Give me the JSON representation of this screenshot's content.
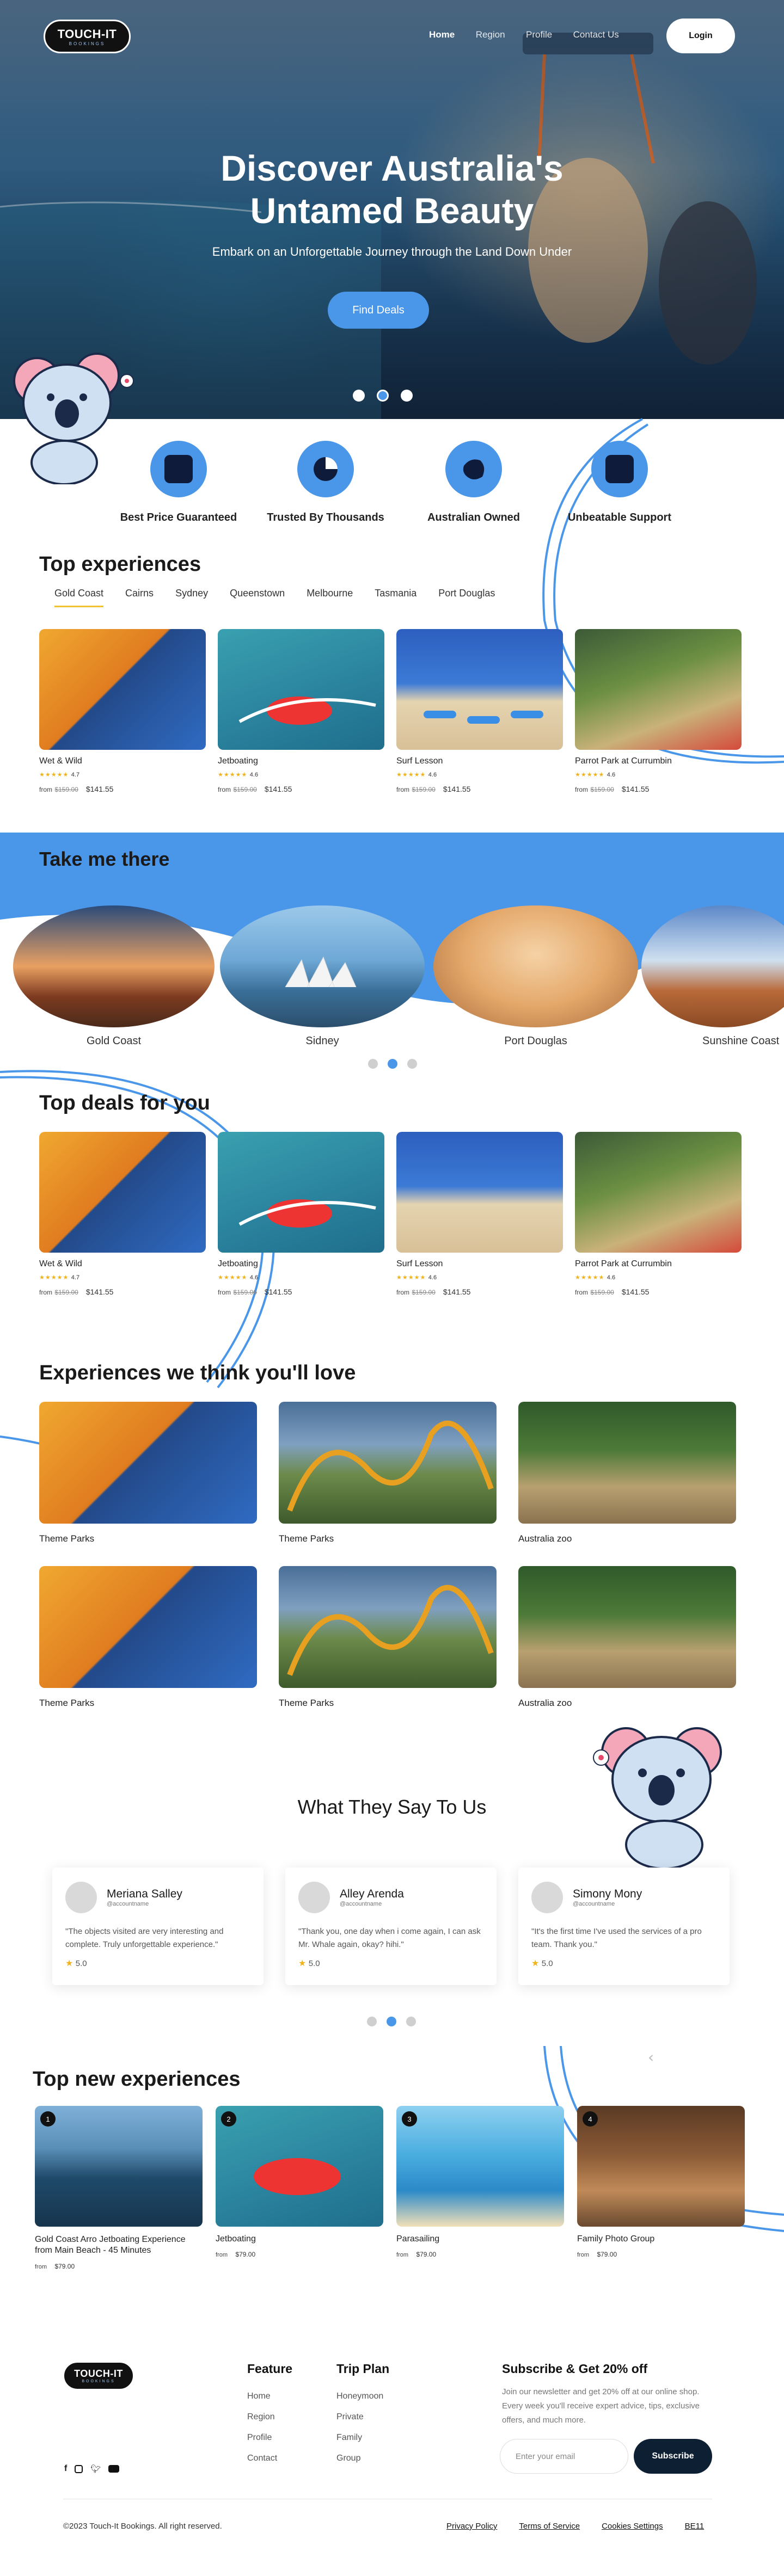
{
  "brand": {
    "name": "TOUCH-IT",
    "tagline": "BOOKINGS"
  },
  "nav": {
    "items": [
      "Home",
      "Region",
      "Profile",
      "Contact Us"
    ],
    "active": "Home",
    "login": "Login"
  },
  "hero": {
    "title": "Discover Australia's Untamed Beauty",
    "subtitle": "Embark on an Unforgettable Journey through the Land Down Under",
    "cta": "Find Deals",
    "slides": 3,
    "active_slide": 2
  },
  "features": [
    {
      "label": "Best Price Guaranteed",
      "icon": "trend-chart-icon"
    },
    {
      "label": "Trusted By Thousands",
      "icon": "pie-chart-icon"
    },
    {
      "label": "Australian Owned",
      "icon": "australia-map-icon"
    },
    {
      "label": "Unbeatable Support",
      "icon": "support-chart-icon"
    }
  ],
  "top_experiences": {
    "title": "Top experiences",
    "tabs": [
      "Gold Coast",
      "Cairns",
      "Sydney",
      "Queenstown",
      "Melbourne",
      "Tasmania",
      "Port Douglas"
    ],
    "active_tab": "Gold Coast",
    "cards": [
      {
        "title": "Wet & Wild",
        "rating": "4.7",
        "from": "from",
        "old_price": "$159.00",
        "price": "$141.55"
      },
      {
        "title": "Jetboating",
        "rating": "4.6",
        "from": "from",
        "old_price": "$159.00",
        "price": "$141.55"
      },
      {
        "title": "Surf Lesson",
        "rating": "4.6",
        "from": "from",
        "old_price": "$159.00",
        "price": "$141.55"
      },
      {
        "title": "Parrot Park at Currumbin",
        "rating": "4.6",
        "from": "from",
        "old_price": "$159.00",
        "price": "$141.55"
      }
    ]
  },
  "take_me_there": {
    "title": "Take me there",
    "destinations": [
      "Gold Coast",
      "Sidney",
      "Port Douglas",
      "Sunshine Coast"
    ]
  },
  "top_deals": {
    "title": "Top deals for you",
    "cards": [
      {
        "title": "Wet & Wild",
        "rating": "4.7",
        "from": "from",
        "old_price": "$159.00",
        "price": "$141.55"
      },
      {
        "title": "Jetboating",
        "rating": "4.6",
        "from": "from",
        "old_price": "$159.00",
        "price": "$141.55"
      },
      {
        "title": "Surf Lesson",
        "rating": "4.6",
        "from": "from",
        "old_price": "$159.00",
        "price": "$141.55"
      },
      {
        "title": "Parrot Park at Currumbin",
        "rating": "4.6",
        "from": "from",
        "old_price": "$159.00",
        "price": "$141.55"
      }
    ]
  },
  "love": {
    "title": "Experiences we think you'll love",
    "items": [
      "Theme Parks",
      "Theme Parks",
      "Australia zoo",
      "Theme Parks",
      "Theme Parks",
      "Australia zoo"
    ]
  },
  "testimonials": {
    "title": "What They Say To Us",
    "items": [
      {
        "name": "Meriana Salley",
        "handle": "@accountname",
        "text": "\"The objects visited are very interesting and complete. Truly unforgettable experience.\"",
        "rating": "5.0"
      },
      {
        "name": "Alley Arenda",
        "handle": "@accountname",
        "text": "\"Thank you, one day when i come again, I can ask Mr. Whale again, okay? hihi.\"",
        "rating": "5.0"
      },
      {
        "name": "Simony Mony",
        "handle": "@accountname",
        "text": "\"It's the first time I've used the services of a pro team. Thank you.\"",
        "rating": "5.0"
      }
    ]
  },
  "new_experiences": {
    "title": "Top new experiences",
    "cards": [
      {
        "num": "1",
        "title": "Gold Coast Arro Jetboating Experience from Main Beach - 45 Minutes",
        "from": "from",
        "price": "$79.00"
      },
      {
        "num": "2",
        "title": "Jetboating",
        "from": "from",
        "price": "$79.00"
      },
      {
        "num": "3",
        "title": "Parasailing",
        "from": "from",
        "price": "$79.00"
      },
      {
        "num": "4",
        "title": "Family Photo Group",
        "from": "from",
        "price": "$79.00"
      }
    ]
  },
  "footer": {
    "feature": {
      "title": "Feature",
      "links": [
        "Home",
        "Region",
        "Profile",
        "Contact"
      ]
    },
    "trip_plan": {
      "title": "Trip Plan",
      "links": [
        "Honeymoon",
        "Private",
        "Family",
        "Group"
      ]
    },
    "subscribe": {
      "title": "Subscribe & Get 20% off",
      "text": "Join our newsletter and get 20% off at our online shop. Every week you'll receive expert advice, tips, exclusive offers, and much more.",
      "placeholder": "Enter your email",
      "button": "Subscribe"
    },
    "social": [
      "facebook-icon",
      "instagram-icon",
      "twitter-icon",
      "youtube-icon"
    ],
    "copyright": "©2023 Touch-It Bookings. All right reserved.",
    "legal": [
      "Privacy Policy",
      "Terms of Service",
      "Cookies Settings",
      "BE11"
    ]
  }
}
